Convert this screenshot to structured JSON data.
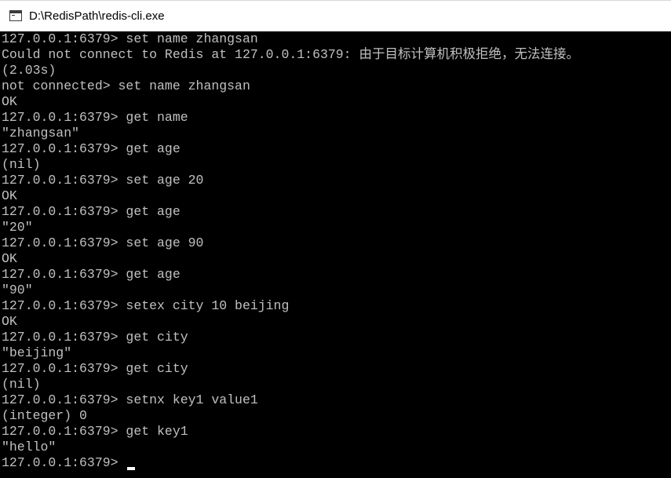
{
  "window": {
    "title": "D:\\RedisPath\\redis-cli.exe",
    "icon": "console-window-icon"
  },
  "console": {
    "lines": [
      "127.0.0.1:6379> set name zhangsan",
      "Could not connect to Redis at 127.0.0.1:6379: 由于目标计算机积极拒绝，无法连接。",
      "(2.03s)",
      "not connected> set name zhangsan",
      "OK",
      "127.0.0.1:6379> get name",
      "\"zhangsan\"",
      "127.0.0.1:6379> get age",
      "(nil)",
      "127.0.0.1:6379> set age 20",
      "OK",
      "127.0.0.1:6379> get age",
      "\"20\"",
      "127.0.0.1:6379> set age 90",
      "OK",
      "127.0.0.1:6379> get age",
      "\"90\"",
      "127.0.0.1:6379> setex city 10 beijing",
      "OK",
      "127.0.0.1:6379> get city",
      "\"beijing\"",
      "127.0.0.1:6379> get city",
      "(nil)",
      "127.0.0.1:6379> setnx key1 value1",
      "(integer) 0",
      "127.0.0.1:6379> get key1",
      "\"hello\"",
      "127.0.0.1:6379> "
    ]
  },
  "colors": {
    "console_background": "#000000",
    "console_text": "#c0c0c0",
    "titlebar_background": "#ffffff",
    "cursor": "#ffffff"
  }
}
